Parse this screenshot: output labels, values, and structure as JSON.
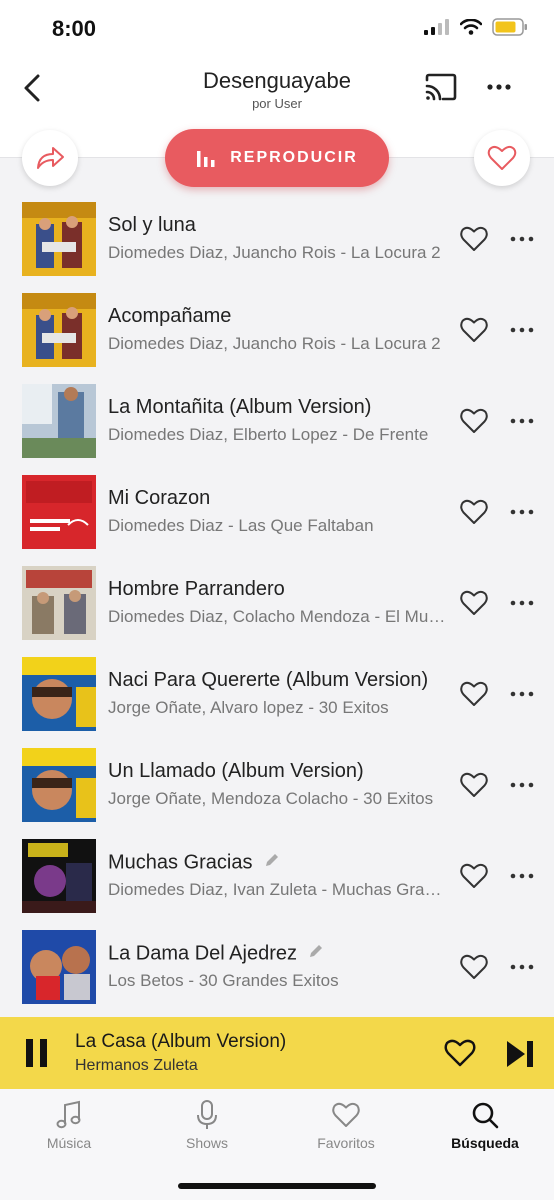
{
  "status": {
    "time": "8:00"
  },
  "header": {
    "title": "Desenguayabe",
    "subtitle": "por User"
  },
  "play_label": "REPRODUCIR",
  "accent_color": "#e85b60",
  "tracks": [
    {
      "title": "Sol y luna",
      "subtitle": "Diomedes Diaz, Juancho Rois - La Locura 2",
      "has_edit": false
    },
    {
      "title": "Acompañame",
      "subtitle": "Diomedes Diaz, Juancho Rois - La Locura 2",
      "has_edit": false
    },
    {
      "title": "La Montañita (Album Version)",
      "subtitle": "Diomedes Diaz, Elberto Lopez - De Frente",
      "has_edit": false
    },
    {
      "title": "Mi Corazon",
      "subtitle": "Diomedes Diaz - Las Que Faltaban",
      "has_edit": false
    },
    {
      "title": "Hombre Parrandero",
      "subtitle": "Diomedes Diaz, Colacho Mendoza - El Mundo",
      "has_edit": false
    },
    {
      "title": "Naci Para Quererte (Album Version)",
      "subtitle": "Jorge Oñate, Alvaro lopez - 30 Exitos",
      "has_edit": false
    },
    {
      "title": "Un Llamado (Album Version)",
      "subtitle": "Jorge Oñate, Mendoza Colacho - 30 Exitos",
      "has_edit": false
    },
    {
      "title": "Muchas Gracias",
      "subtitle": "Diomedes Diaz, Ivan Zuleta - Muchas Gracias",
      "has_edit": true
    },
    {
      "title": "La Dama Del Ajedrez",
      "subtitle": "Los Betos - 30 Grandes Exitos",
      "has_edit": true
    }
  ],
  "now_playing": {
    "title": "La Casa (Album Version)",
    "artist": "Hermanos Zuleta",
    "bar_color": "#f3d84a"
  },
  "tabs": [
    {
      "label": "Música",
      "icon": "music-note-icon"
    },
    {
      "label": "Shows",
      "icon": "microphone-icon"
    },
    {
      "label": "Favoritos",
      "icon": "heart-icon"
    },
    {
      "label": "Búsqueda",
      "icon": "search-icon",
      "active": true
    }
  ]
}
